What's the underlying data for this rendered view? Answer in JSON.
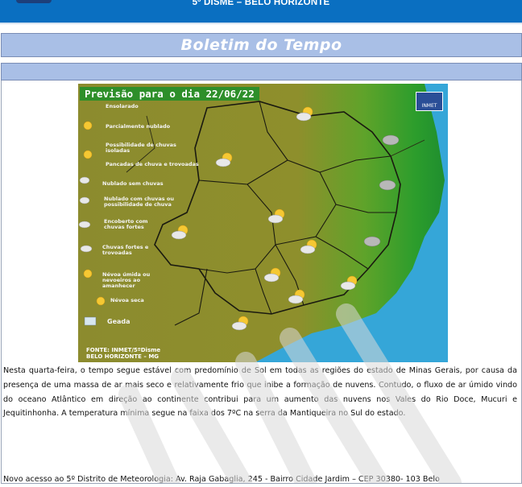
{
  "header": {
    "title": "5º DISME – BELO HORIZONTE"
  },
  "section": {
    "title": "Boletim do Tempo"
  },
  "map": {
    "title": "Previsão para o dia 22/06/22",
    "badge": "INMET",
    "legend": [
      "Ensolarado",
      "Parcialmente nublado",
      "Possibilidade de chuvas isoladas",
      "Pancadas de chuva e trovoadas",
      "Nublado sem chuvas",
      "Nublado com chuvas ou possibilidade de chuva",
      "Encoberto com chuvas fortes",
      "Chuvas fortes e trovoadas",
      "Névoa úmida ou nevoeiros ao amanhecer",
      "Névoa seca",
      "Geada"
    ],
    "source_line1": "FONTE: INMET/5ºDisme",
    "source_line2": "BELO HORIZONTE – MG",
    "colors": {
      "land": "#8a8a2a",
      "coast_green": "#2fa02a",
      "ocean": "#35a6d8"
    }
  },
  "body": {
    "paragraph1": "Nesta quarta-feira, o tempo segue estável com predomínio de Sol em todas as regiões do estado de Minas Gerais, por causa da presença de uma massa de ar mais seco e relativamente frio que inibe a formação de nuvens. Contudo, o fluxo de ar úmido vindo do oceano Atlântico em direção ao continente contribui para um aumento das nuvens nos Vales do Rio Doce, Mucuri e Jequitinhonha. A temperatura mínima segue na faixa dos 7ºC na serra da Mantiqueira no Sul do estado.",
    "paragraph2": "Novo acesso ao 5º Distrito de Meteorologia: Av. Raja Gabaglia, 245 - Bairro Cidade Jardim – CEP 30380- 103 Belo"
  }
}
